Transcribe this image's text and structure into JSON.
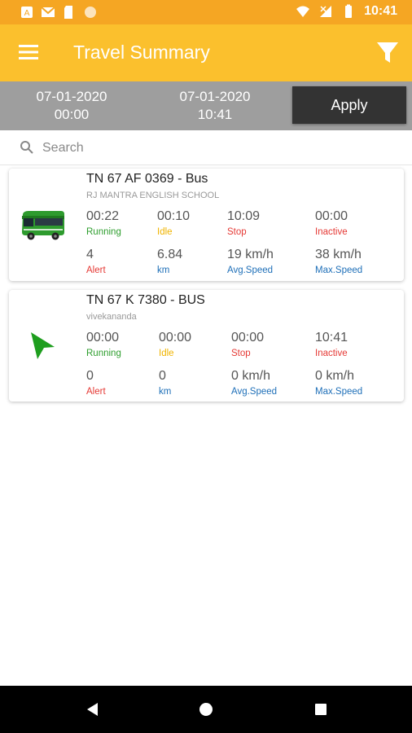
{
  "status_bar": {
    "time": "10:41"
  },
  "app_bar": {
    "title": "Travel Summary"
  },
  "date_filter": {
    "from_date": "07-01-2020",
    "from_time": "00:00",
    "to_date": "07-01-2020",
    "to_time": "10:41",
    "apply_label": "Apply"
  },
  "search": {
    "placeholder": "Search"
  },
  "vehicles": [
    {
      "name": "TN 67 AF 0369 - Bus",
      "group": "RJ MANTRA ENGLISH SCHOOL",
      "icon": "bus-icon",
      "running": "00:22",
      "running_label": "Running",
      "idle": "00:10",
      "idle_label": "Idle",
      "stop": "10:09",
      "stop_label": "Stop",
      "inactive": "00:00",
      "inactive_label": "Inactive",
      "alert": "4",
      "alert_label": "Alert",
      "km": "6.84",
      "km_label": "km",
      "avg_speed": "19 km/h",
      "avg_speed_label": "Avg.Speed",
      "max_speed": "38 km/h",
      "max_speed_label": "Max.Speed"
    },
    {
      "name": "TN 67 K 7380 - BUS",
      "group": "vivekananda",
      "icon": "navigation-arrow-icon",
      "running": "00:00",
      "running_label": "Running",
      "idle": "00:00",
      "idle_label": "Idle",
      "stop": "00:00",
      "stop_label": "Stop",
      "inactive": "10:41",
      "inactive_label": "Inactive",
      "alert": "0",
      "alert_label": "Alert",
      "km": "0",
      "km_label": "km",
      "avg_speed": "0 km/h",
      "avg_speed_label": "Avg.Speed",
      "max_speed": "0 km/h",
      "max_speed_label": "Max.Speed"
    }
  ],
  "colors": {
    "app_bar": "#FBC02D",
    "status_bar": "#F5A623",
    "date_bar": "#9E9E9E",
    "running": "#2E9E2E",
    "idle": "#F0B400",
    "stop": "#E53935",
    "distance": "#1E6FB8"
  }
}
